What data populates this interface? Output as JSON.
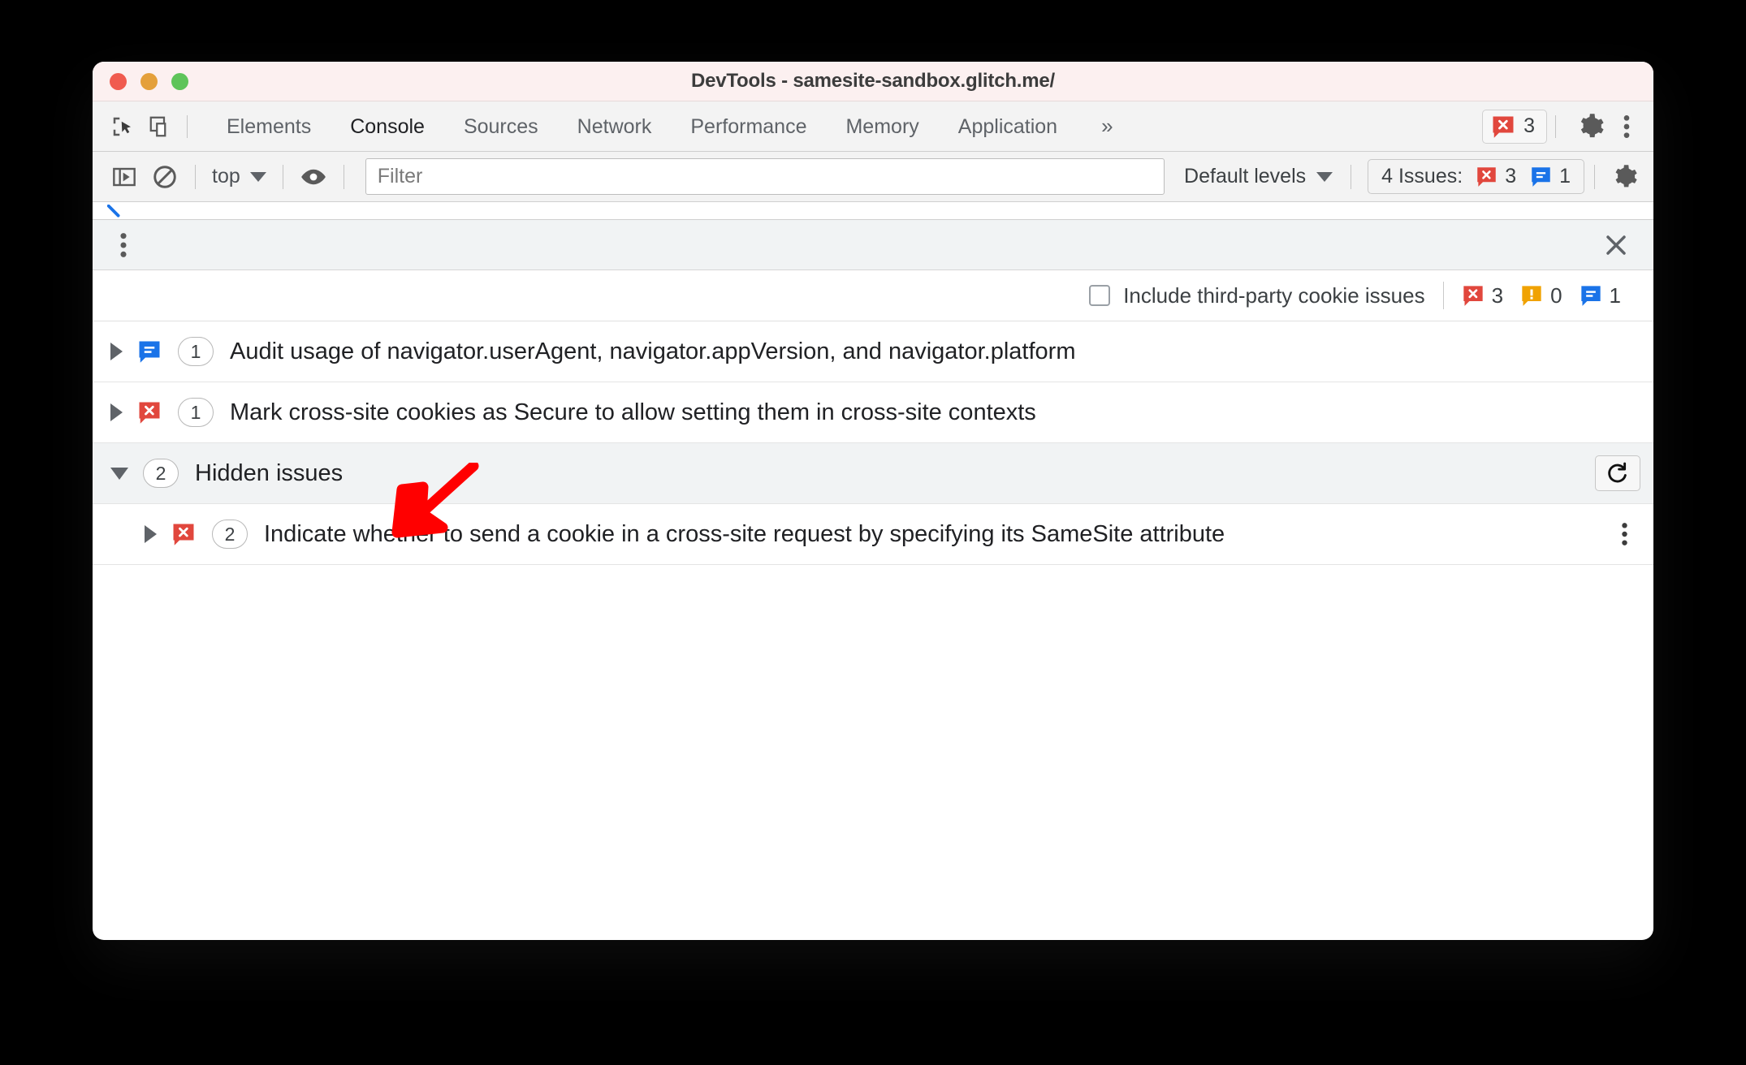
{
  "window": {
    "title": "DevTools - samesite-sandbox.glitch.me/",
    "traffic_lights": [
      "close",
      "minimize",
      "maximize"
    ]
  },
  "tabbar": {
    "inspect_icon": "inspect-element-icon",
    "device_icon": "device-toolbar-icon",
    "tabs": [
      {
        "label": "Elements",
        "active": false
      },
      {
        "label": "Console",
        "active": true
      },
      {
        "label": "Sources",
        "active": false
      },
      {
        "label": "Network",
        "active": false
      },
      {
        "label": "Performance",
        "active": false
      },
      {
        "label": "Memory",
        "active": false
      },
      {
        "label": "Application",
        "active": false
      }
    ],
    "more_tabs": "»",
    "error_badge": {
      "icon": "error-bubble-icon",
      "count": "3"
    },
    "settings_icon": "gear-icon",
    "menu_icon": "kebab-menu-icon"
  },
  "console_toolbar": {
    "sidebar_toggle_icon": "console-sidebar-icon",
    "clear_icon": "clear-console-icon",
    "context_selector": "top",
    "eye_icon": "live-expression-icon",
    "filter_placeholder": "Filter",
    "filter_value": "",
    "levels_selector": "Default levels",
    "issues_pill": {
      "label": "4 Issues:",
      "errors": "3",
      "infos": "1"
    },
    "settings_icon": "gear-icon"
  },
  "drawer": {
    "menu_icon": "kebab-menu-icon",
    "close_icon": "close-icon",
    "filter_row": {
      "checkbox_label": "Include third-party cookie issues",
      "checked": false,
      "errors": "3",
      "warnings": "0",
      "infos": "1"
    },
    "issues": [
      {
        "expanded": false,
        "severity": "info",
        "count": "1",
        "title": "Audit usage of navigator.userAgent, navigator.appVersion, and navigator.platform"
      },
      {
        "expanded": false,
        "severity": "error",
        "count": "1",
        "title": "Mark cross-site cookies as Secure to allow setting them in cross-site contexts"
      }
    ],
    "hidden_group": {
      "expanded": true,
      "count": "2",
      "title": "Hidden issues",
      "refresh_icon": "refresh-icon",
      "children": [
        {
          "expanded": false,
          "severity": "error",
          "count": "2",
          "title": "Indicate whether to send a cookie in a cross-site request by specifying its SameSite attribute",
          "menu_icon": "kebab-menu-icon"
        }
      ]
    }
  },
  "annotation": {
    "arrow": "red-pointer-arrow",
    "color": "#ff0000"
  },
  "colors": {
    "error_red": "#e1473d",
    "warning_orange": "#f0a202",
    "info_blue": "#1a73e8",
    "titlebar_bg": "#fcf0f0",
    "toolbar_bg": "#f3f3f3",
    "drawer_bg": "#f1f3f4"
  }
}
